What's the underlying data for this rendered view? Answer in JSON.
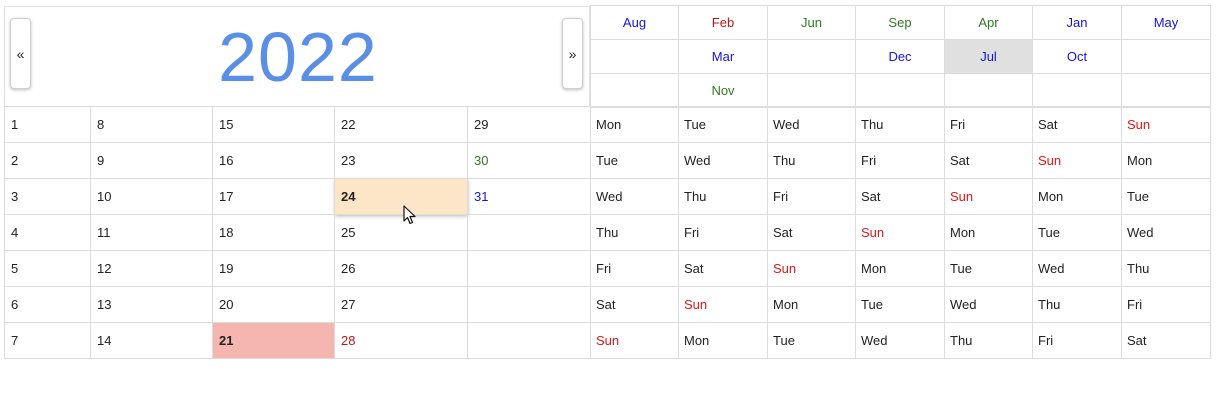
{
  "year": "2022",
  "nav": {
    "prev": "«",
    "next": "»"
  },
  "colors": {
    "blue": "#1515d6",
    "red": "#b51a1a",
    "green": "#2f7a1f",
    "sunday": "#e01818",
    "title": "#5b8ee5"
  },
  "month_rows": [
    [
      {
        "l": "Aug",
        "c": "blue"
      },
      {
        "l": "Feb",
        "c": "red"
      },
      {
        "l": "Jun",
        "c": "green"
      },
      {
        "l": "Sep",
        "c": "green"
      },
      {
        "l": "Apr",
        "c": "green"
      },
      {
        "l": "Jan",
        "c": "blue"
      },
      {
        "l": "May",
        "c": "blue"
      }
    ],
    [
      {
        "l": "",
        "c": ""
      },
      {
        "l": "Mar",
        "c": "blue"
      },
      {
        "l": "",
        "c": ""
      },
      {
        "l": "Dec",
        "c": "blue"
      },
      {
        "l": "Jul",
        "c": "blue",
        "selected": true
      },
      {
        "l": "Oct",
        "c": "blue"
      },
      {
        "l": "",
        "c": ""
      }
    ],
    [
      {
        "l": "",
        "c": ""
      },
      {
        "l": "Nov",
        "c": "green"
      },
      {
        "l": "",
        "c": ""
      },
      {
        "l": "",
        "c": ""
      },
      {
        "l": "",
        "c": ""
      },
      {
        "l": "",
        "c": ""
      },
      {
        "l": "",
        "c": ""
      }
    ]
  ],
  "day_rows": [
    [
      {
        "l": "1"
      },
      {
        "l": "8"
      },
      {
        "l": "15"
      },
      {
        "l": "22"
      },
      {
        "l": "29"
      }
    ],
    [
      {
        "l": "2"
      },
      {
        "l": "9"
      },
      {
        "l": "16"
      },
      {
        "l": "23"
      },
      {
        "l": "30",
        "c": "green"
      }
    ],
    [
      {
        "l": "3"
      },
      {
        "l": "10"
      },
      {
        "l": "17"
      },
      {
        "l": "24",
        "state": "hover"
      },
      {
        "l": "31",
        "c": "blue"
      }
    ],
    [
      {
        "l": "4"
      },
      {
        "l": "11"
      },
      {
        "l": "18"
      },
      {
        "l": "25"
      },
      {
        "l": ""
      }
    ],
    [
      {
        "l": "5"
      },
      {
        "l": "12"
      },
      {
        "l": "19"
      },
      {
        "l": "26"
      },
      {
        "l": ""
      }
    ],
    [
      {
        "l": "6"
      },
      {
        "l": "13"
      },
      {
        "l": "20"
      },
      {
        "l": "27"
      },
      {
        "l": ""
      }
    ],
    [
      {
        "l": "7"
      },
      {
        "l": "14"
      },
      {
        "l": "21",
        "state": "today"
      },
      {
        "l": "28",
        "c": "red"
      },
      {
        "l": ""
      }
    ]
  ],
  "weekday_rows": [
    [
      "Mon",
      "Tue",
      "Wed",
      "Thu",
      "Fri",
      "Sat",
      "Sun"
    ],
    [
      "Tue",
      "Wed",
      "Thu",
      "Fri",
      "Sat",
      "Sun",
      "Mon"
    ],
    [
      "Wed",
      "Thu",
      "Fri",
      "Sat",
      "Sun",
      "Mon",
      "Tue"
    ],
    [
      "Thu",
      "Fri",
      "Sat",
      "Sun",
      "Mon",
      "Tue",
      "Wed"
    ],
    [
      "Fri",
      "Sat",
      "Sun",
      "Mon",
      "Tue",
      "Wed",
      "Thu"
    ],
    [
      "Sat",
      "Sun",
      "Mon",
      "Tue",
      "Wed",
      "Thu",
      "Fri"
    ],
    [
      "Sun",
      "Mon",
      "Tue",
      "Wed",
      "Thu",
      "Fri",
      "Sat"
    ]
  ]
}
